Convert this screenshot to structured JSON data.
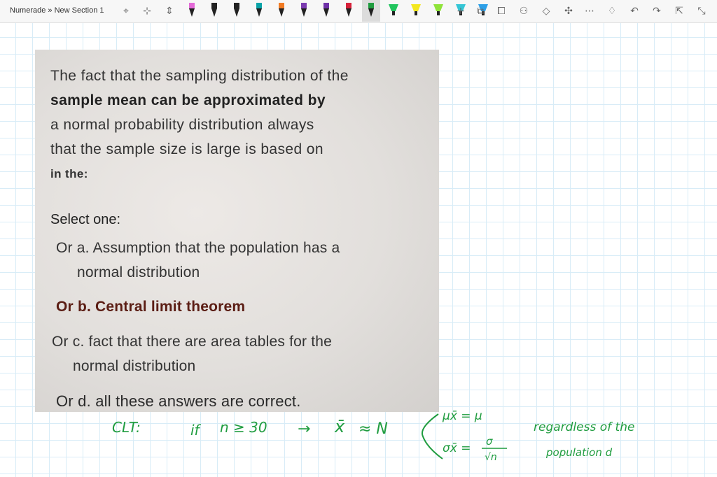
{
  "app": {
    "breadcrumb": "Numerade » New Section 1"
  },
  "toolbar": {
    "left_icons": [
      "lasso-select-icon",
      "shape-select-icon",
      "insert-space-icon"
    ],
    "pens": [
      {
        "name": "pen-pink",
        "color": "#e46ad8"
      },
      {
        "name": "pen-black",
        "color": "#222222"
      },
      {
        "name": "pen-black-2",
        "color": "#222222"
      },
      {
        "name": "pen-teal",
        "color": "#0aa3a8"
      },
      {
        "name": "pen-orange",
        "color": "#f17b23"
      },
      {
        "name": "pen-purple",
        "color": "#7b3bb0"
      },
      {
        "name": "pen-purple-2",
        "color": "#6f31a8"
      },
      {
        "name": "pen-red",
        "color": "#d6213a"
      },
      {
        "name": "pen-green-active",
        "color": "#1f9c3f"
      },
      {
        "name": "highlighter-green",
        "color": "#22c55e"
      },
      {
        "name": "highlighter-yellow",
        "color": "#f3e71f"
      },
      {
        "name": "highlighter-lime",
        "color": "#8fe33a"
      },
      {
        "name": "highlighter-cyan",
        "color": "#35c6d6"
      },
      {
        "name": "highlighter-blue",
        "color": "#2da0e8"
      }
    ],
    "right_icons": [
      "add-pen-icon",
      "lasso-icon",
      "ink-to-shape-icon",
      "ink-to-text-icon",
      "eraser-icon",
      "math-icon",
      "more-icon",
      "bell-icon",
      "undo-icon",
      "redo-icon",
      "share-icon",
      "fullscreen-icon"
    ]
  },
  "question": {
    "line1": "The fact that the sampling distribution of the",
    "line2": "sample mean can be approximated by",
    "line3": "a normal probability distribution always",
    "line4": "that the sample size is large is based on",
    "line5": "in the:",
    "select_label": "Select one:",
    "option_a_line1": "Or a. Assumption that the population has a",
    "option_a_line2": "normal distribution",
    "option_b": "Or b. Central limit theorem",
    "option_c_line1": "Or c. fact that there are area tables for the",
    "option_c_line2": "normal distribution",
    "option_d": "Or d. all these answers are correct."
  },
  "handwriting": {
    "clt": "CLT:",
    "if": "if",
    "condition": "n ≥ 30",
    "arrow": "→",
    "xbar": "x̄",
    "approx": "≈ N",
    "mean": "μx̄ = μ",
    "sd_left": "σx̄ =",
    "sd_num": "σ",
    "sd_den": "√n",
    "note_line1": "regardless of the",
    "note_line2": "population d"
  }
}
